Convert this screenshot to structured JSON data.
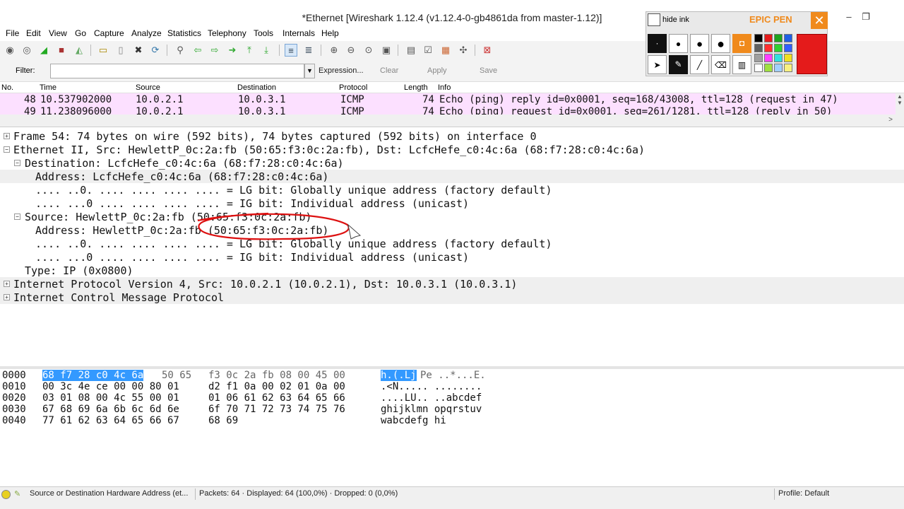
{
  "window": {
    "title": "*Ethernet   [Wireshark 1.12.4  (v1.12.4-0-gb4861da from master-1.12)]",
    "minimize": "–",
    "restore": "❐",
    "close": "✕"
  },
  "menu": [
    "File",
    "Edit",
    "View",
    "Go",
    "Capture",
    "Analyze",
    "Statistics",
    "Telephony",
    "Tools",
    "Internals",
    "Help"
  ],
  "filter": {
    "label": "Filter:",
    "value": "",
    "placeholder": "",
    "expression": "Expression...",
    "clear": "Clear",
    "apply": "Apply",
    "save": "Save"
  },
  "packet_list": {
    "columns": [
      "No.",
      "Time",
      "Source",
      "Destination",
      "Protocol",
      "Length",
      "Info"
    ],
    "rows": [
      {
        "no": "48",
        "time": "10.537902000",
        "src": "10.0.2.1",
        "dst": "10.0.3.1",
        "proto": "ICMP",
        "len": "74",
        "info": "Echo (ping) reply    id=0x0001, seq=168/43008, ttl=128 (request in 47)"
      },
      {
        "no": "49",
        "time": "11.238096000",
        "src": "10.0.2.1",
        "dst": "10.0.3.1",
        "proto": "ICMP",
        "len": "74",
        "info": "Echo (ping) request  id=0x0001, seq=261/1281, ttl=128 (reply in 50)"
      }
    ]
  },
  "details": [
    {
      "text": "Frame 54: 74 bytes on wire (592 bits), 74 bytes captured (592 bits) on interface 0",
      "expander": "⊞"
    },
    {
      "text": "Ethernet II, Src: HewlettP_0c:2a:fb (50:65:f3:0c:2a:fb), Dst: LcfcHefe_c0:4c:6a (68:f7:28:c0:4c:6a)",
      "expander": "⊟"
    },
    {
      "text": "Destination: LcfcHefe_c0:4c:6a (68:f7:28:c0:4c:6a)",
      "expander": "⊟"
    },
    {
      "text": "Address: LcfcHefe_c0:4c:6a (68:f7:28:c0:4c:6a)",
      "expander": ""
    },
    {
      "text": ".... ..0. .... .... .... .... = LG bit: Globally unique address (factory default)",
      "expander": ""
    },
    {
      "text": ".... ...0 .... .... .... .... = IG bit: Individual address (unicast)",
      "expander": ""
    },
    {
      "text": "Source: HewlettP_0c:2a:fb (50:65:f3:0c:2a:fb)",
      "expander": "⊟"
    },
    {
      "text": "Address: HewlettP_0c:2a:fb (50:65:f3:0c:2a:fb)",
      "expander": ""
    },
    {
      "text": ".... ..0. .... .... .... .... = LG bit: Globally unique address (factory default)",
      "expander": ""
    },
    {
      "text": ".... ...0 .... .... .... .... = IG bit: Individual address (unicast)",
      "expander": ""
    },
    {
      "text": "Type: IP (0x0800)",
      "expander": ""
    },
    {
      "text": "Internet Protocol Version 4, Src: 10.0.2.1 (10.0.2.1), Dst: 10.0.3.1 (10.0.3.1)",
      "expander": "⊞"
    },
    {
      "text": "Internet Control Message Protocol",
      "expander": "⊞"
    }
  ],
  "hex": {
    "rows": [
      {
        "offset": "0000",
        "sel": "68 f7 28 c0 4c 6a",
        "rest1": "50 65",
        "group2": "f3 0c 2a fb 08 00 45 00",
        "ascii_sel": "h.(.Lj",
        "ascii_rest": "Pe ..*...E."
      },
      {
        "offset": "0010",
        "sel": "",
        "rest1": "00 3c 4e ce 00 00 80 01",
        "group2": "d2 f1 0a 00 02 01 0a 00",
        "ascii_sel": "",
        "ascii_rest": ".<N..... ........"
      },
      {
        "offset": "0020",
        "sel": "",
        "rest1": "03 01 08 00 4c 55 00 01",
        "group2": "01 06 61 62 63 64 65 66",
        "ascii_sel": "",
        "ascii_rest": "....LU.. ..abcdef"
      },
      {
        "offset": "0030",
        "sel": "",
        "rest1": "67 68 69 6a 6b 6c 6d 6e",
        "group2": "6f 70 71 72 73 74 75 76",
        "ascii_sel": "",
        "ascii_rest": "ghijklmn opqrstuv"
      },
      {
        "offset": "0040",
        "sel": "",
        "rest1": "77 61 62 63 64 65 66 67",
        "group2": "68 69",
        "ascii_sel": "",
        "ascii_rest": "wabcdefg hi"
      }
    ]
  },
  "status": {
    "field": "Source or Destination Hardware Address (et...",
    "packets": "Packets: 64 · Displayed: 64 (100,0%) · Dropped: 0 (0,0%)",
    "profile": "Profile: Default"
  },
  "epic_pen": {
    "hide_label": "hide ink",
    "brand": "EPIC PEN",
    "swatches": [
      "#000000",
      "#e41b1b",
      "#1fa31f",
      "#1f5fe4",
      "#606060",
      "#ff3030",
      "#30d030",
      "#3060ff",
      "#a0a0a0",
      "#ff40ff",
      "#30e0e0",
      "#f0e020",
      "#ffffff",
      "#a0e040",
      "#a0d0ff",
      "#f8f080"
    ],
    "active_color": "#e41b1b"
  }
}
